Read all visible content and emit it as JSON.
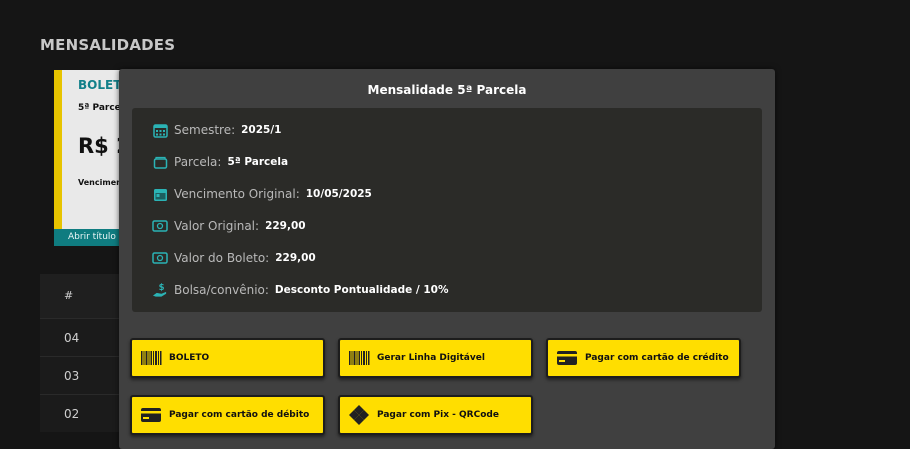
{
  "page": {
    "title": "MENSALIDADES"
  },
  "card": {
    "type": "BOLET",
    "parcel": "5ª Parcel",
    "amount": "R$ 2",
    "due": "Vencimen",
    "open_link": "Abrir título"
  },
  "table": {
    "header": "#",
    "rows": [
      "04",
      "03",
      "02"
    ]
  },
  "modal": {
    "title": "Mensalidade 5ª Parcela",
    "fields": [
      {
        "icon": "calendar-grid-icon",
        "label": "Semestre:",
        "value": "2025/1"
      },
      {
        "icon": "wallet-icon",
        "label": "Parcela:",
        "value": "5ª Parcela"
      },
      {
        "icon": "calendar-icon",
        "label": "Vencimento Original:",
        "value": "10/05/2025"
      },
      {
        "icon": "money-icon",
        "label": "Valor Original:",
        "value": "229,00"
      },
      {
        "icon": "money-icon",
        "label": "Valor do Boleto:",
        "value": "229,00"
      },
      {
        "icon": "hand-dollar-icon",
        "label": "Bolsa/convênio:",
        "value": "Desconto Pontualidade / 10%"
      }
    ],
    "buttons": [
      {
        "icon": "barcode-icon",
        "label": "BOLETO"
      },
      {
        "icon": "barcode-icon",
        "label": "Gerar Linha Digitável"
      },
      {
        "icon": "credit-card-icon",
        "label": "Pagar com cartão de crédito"
      },
      {
        "icon": "credit-card-icon",
        "label": "Pagar com cartão de débito"
      },
      {
        "icon": "pix-icon",
        "label": "Pagar com Pix - QRCode"
      }
    ],
    "colors": {
      "accent": "#ffde00",
      "teal": "#12808a",
      "icon": "#2bb3b5"
    }
  }
}
